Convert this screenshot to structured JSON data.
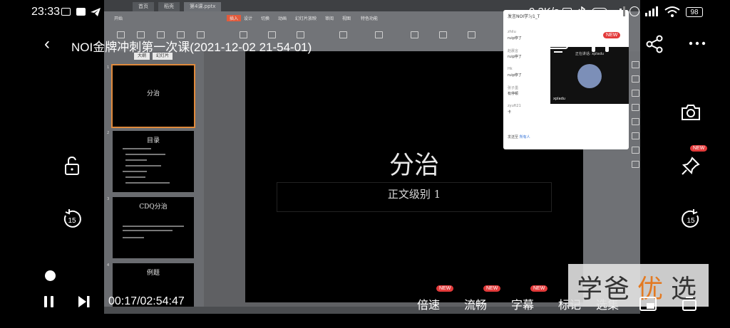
{
  "status_bar": {
    "time": "23:33",
    "net_speed": "9.3K/s",
    "battery": "98"
  },
  "header": {
    "title": "NOI金牌冲刺第一次课(2021-12-02 21-54-01)",
    "new_badge": "NEW"
  },
  "recording": {
    "tabs": [
      "首页",
      "稻壳",
      "第4课.pptx"
    ],
    "ribbon_items": [
      "开始",
      "插入",
      "设计",
      "切换",
      "动画",
      "幻灯片放映",
      "审阅",
      "视图",
      "特色功能"
    ],
    "left_pane_tabs": [
      "大纲",
      "幻灯片"
    ],
    "thumbnails": [
      {
        "num": "1",
        "title": "分治"
      },
      {
        "num": "2",
        "title": "目录"
      },
      {
        "num": "3",
        "title": "CDQ分治"
      },
      {
        "num": "4",
        "title": "例题"
      }
    ],
    "slide": {
      "title": "分治",
      "subtitle": "正文级别 1"
    },
    "chat": {
      "header": "发言NOI学习1_T",
      "messages": [
        {
          "name": "zhilu",
          "text": "ruip停了"
        },
        {
          "name": "赵晨言",
          "text": "ruip停了"
        },
        {
          "name": "Hk",
          "text": "ruip停了"
        },
        {
          "name": "张子墨",
          "text": "有停顿"
        },
        {
          "name": "zyuft21",
          "text": "卡"
        }
      ],
      "input_prefix": "发送至",
      "input_target": "所有人",
      "video_label": "正在讲话: xpladu",
      "video_name": "xpladu"
    }
  },
  "player": {
    "time": "00:17/02:54:47",
    "controls": [
      {
        "label": "倍速",
        "badge": "NEW"
      },
      {
        "label": "流畅",
        "badge": "NEW"
      },
      {
        "label": "字幕",
        "badge": "NEW"
      },
      {
        "label": "标记",
        "badge": ""
      },
      {
        "label": "选集",
        "badge": ""
      }
    ],
    "rewind_seconds": "15",
    "forward_seconds": "15",
    "pin_badge": "NEW"
  },
  "watermark": {
    "left": "学爸",
    "accent": "优",
    "right": "选"
  }
}
